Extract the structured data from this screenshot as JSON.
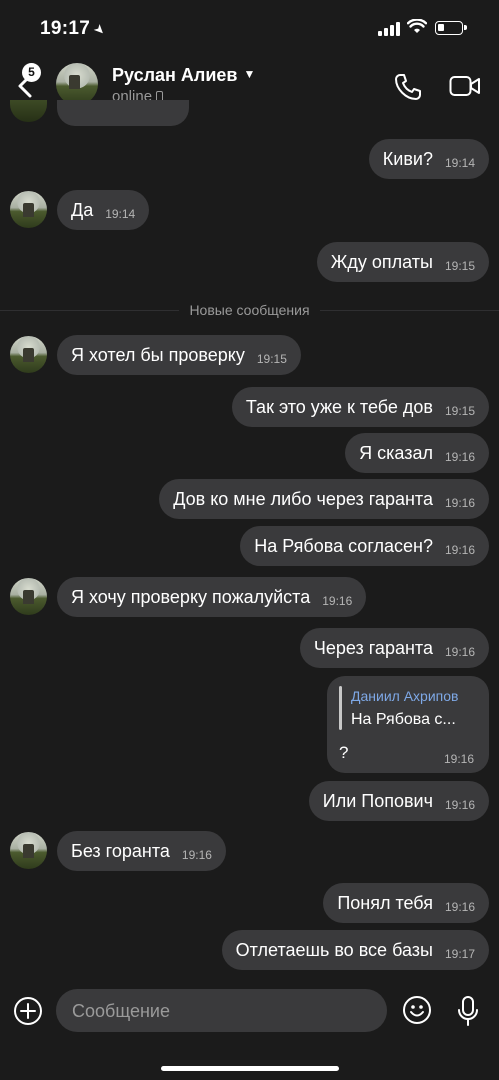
{
  "status_bar": {
    "time": "19:17"
  },
  "header": {
    "back_badge": "5",
    "contact_name": "Руслан Алиев",
    "status": "online"
  },
  "divider": "Новые сообщения",
  "messages": [
    {
      "dir": "out",
      "text": "Киви?",
      "time": "19:14"
    },
    {
      "dir": "in",
      "text": "Да",
      "time": "19:14"
    },
    {
      "dir": "out",
      "text": "Жду оплаты",
      "time": "19:15"
    },
    {
      "dir": "in",
      "text": "Я хотел бы проверку",
      "time": "19:15"
    },
    {
      "dir": "out",
      "text": "Так это уже к тебе дов",
      "time": "19:15"
    },
    {
      "dir": "out",
      "text": "Я сказал",
      "time": "19:16"
    },
    {
      "dir": "out",
      "text": "Дов ко мне либо через гаранта",
      "time": "19:16"
    },
    {
      "dir": "out",
      "text": "На Рябова согласен?",
      "time": "19:16"
    },
    {
      "dir": "in",
      "text": "Я хочу проверку пожалуйста",
      "time": "19:16"
    },
    {
      "dir": "out",
      "text": "Через гаранта",
      "time": "19:16"
    },
    {
      "dir": "out",
      "text": "Или Попович",
      "time": "19:16"
    },
    {
      "dir": "in",
      "text": "Без горанта",
      "time": "19:16"
    },
    {
      "dir": "out",
      "text": "Понял тебя",
      "time": "19:16"
    },
    {
      "dir": "out",
      "text": "Отлетаешь во все базы",
      "time": "19:17"
    }
  ],
  "reply_message": {
    "quoted_author": "Даниил Ахрипов",
    "quoted_text": "На Рябова с...",
    "text": "?",
    "time": "19:16"
  },
  "composer": {
    "placeholder": "Сообщение"
  },
  "colors": {
    "background": "#1b1b1b",
    "bubble": "#3a3a3c",
    "reply_author": "#7ea8e6"
  }
}
